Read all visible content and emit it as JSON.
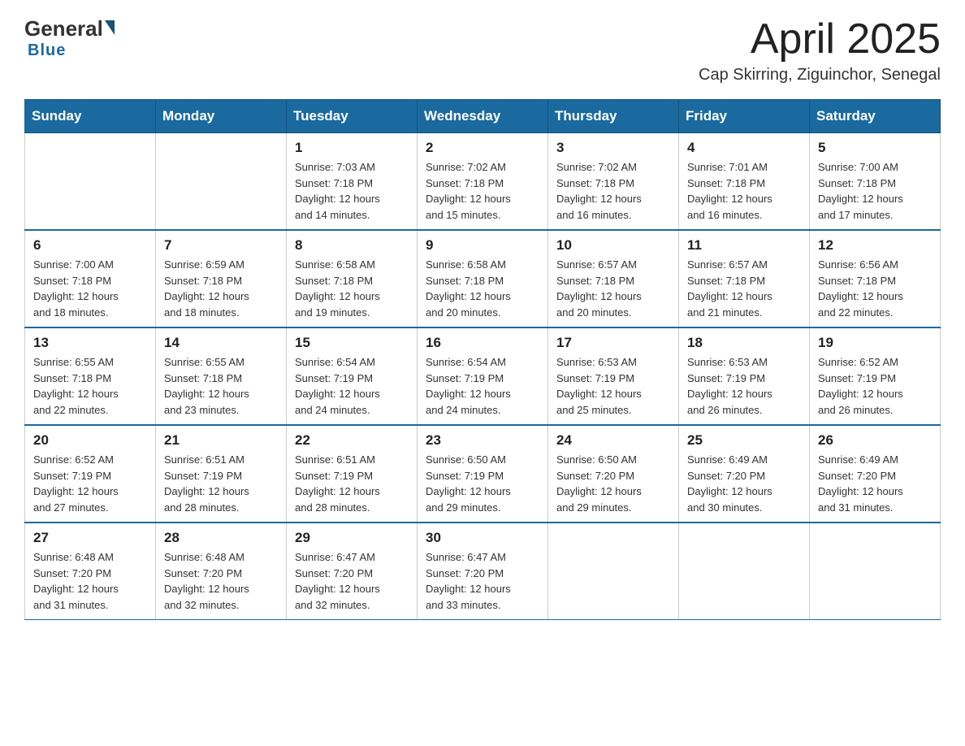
{
  "logo": {
    "general": "General",
    "blue": "Blue"
  },
  "title": {
    "month_year": "April 2025",
    "location": "Cap Skirring, Ziguinchor, Senegal"
  },
  "headers": [
    "Sunday",
    "Monday",
    "Tuesday",
    "Wednesday",
    "Thursday",
    "Friday",
    "Saturday"
  ],
  "weeks": [
    [
      {
        "day": "",
        "info": ""
      },
      {
        "day": "",
        "info": ""
      },
      {
        "day": "1",
        "info": "Sunrise: 7:03 AM\nSunset: 7:18 PM\nDaylight: 12 hours\nand 14 minutes."
      },
      {
        "day": "2",
        "info": "Sunrise: 7:02 AM\nSunset: 7:18 PM\nDaylight: 12 hours\nand 15 minutes."
      },
      {
        "day": "3",
        "info": "Sunrise: 7:02 AM\nSunset: 7:18 PM\nDaylight: 12 hours\nand 16 minutes."
      },
      {
        "day": "4",
        "info": "Sunrise: 7:01 AM\nSunset: 7:18 PM\nDaylight: 12 hours\nand 16 minutes."
      },
      {
        "day": "5",
        "info": "Sunrise: 7:00 AM\nSunset: 7:18 PM\nDaylight: 12 hours\nand 17 minutes."
      }
    ],
    [
      {
        "day": "6",
        "info": "Sunrise: 7:00 AM\nSunset: 7:18 PM\nDaylight: 12 hours\nand 18 minutes."
      },
      {
        "day": "7",
        "info": "Sunrise: 6:59 AM\nSunset: 7:18 PM\nDaylight: 12 hours\nand 18 minutes."
      },
      {
        "day": "8",
        "info": "Sunrise: 6:58 AM\nSunset: 7:18 PM\nDaylight: 12 hours\nand 19 minutes."
      },
      {
        "day": "9",
        "info": "Sunrise: 6:58 AM\nSunset: 7:18 PM\nDaylight: 12 hours\nand 20 minutes."
      },
      {
        "day": "10",
        "info": "Sunrise: 6:57 AM\nSunset: 7:18 PM\nDaylight: 12 hours\nand 20 minutes."
      },
      {
        "day": "11",
        "info": "Sunrise: 6:57 AM\nSunset: 7:18 PM\nDaylight: 12 hours\nand 21 minutes."
      },
      {
        "day": "12",
        "info": "Sunrise: 6:56 AM\nSunset: 7:18 PM\nDaylight: 12 hours\nand 22 minutes."
      }
    ],
    [
      {
        "day": "13",
        "info": "Sunrise: 6:55 AM\nSunset: 7:18 PM\nDaylight: 12 hours\nand 22 minutes."
      },
      {
        "day": "14",
        "info": "Sunrise: 6:55 AM\nSunset: 7:18 PM\nDaylight: 12 hours\nand 23 minutes."
      },
      {
        "day": "15",
        "info": "Sunrise: 6:54 AM\nSunset: 7:19 PM\nDaylight: 12 hours\nand 24 minutes."
      },
      {
        "day": "16",
        "info": "Sunrise: 6:54 AM\nSunset: 7:19 PM\nDaylight: 12 hours\nand 24 minutes."
      },
      {
        "day": "17",
        "info": "Sunrise: 6:53 AM\nSunset: 7:19 PM\nDaylight: 12 hours\nand 25 minutes."
      },
      {
        "day": "18",
        "info": "Sunrise: 6:53 AM\nSunset: 7:19 PM\nDaylight: 12 hours\nand 26 minutes."
      },
      {
        "day": "19",
        "info": "Sunrise: 6:52 AM\nSunset: 7:19 PM\nDaylight: 12 hours\nand 26 minutes."
      }
    ],
    [
      {
        "day": "20",
        "info": "Sunrise: 6:52 AM\nSunset: 7:19 PM\nDaylight: 12 hours\nand 27 minutes."
      },
      {
        "day": "21",
        "info": "Sunrise: 6:51 AM\nSunset: 7:19 PM\nDaylight: 12 hours\nand 28 minutes."
      },
      {
        "day": "22",
        "info": "Sunrise: 6:51 AM\nSunset: 7:19 PM\nDaylight: 12 hours\nand 28 minutes."
      },
      {
        "day": "23",
        "info": "Sunrise: 6:50 AM\nSunset: 7:19 PM\nDaylight: 12 hours\nand 29 minutes."
      },
      {
        "day": "24",
        "info": "Sunrise: 6:50 AM\nSunset: 7:20 PM\nDaylight: 12 hours\nand 29 minutes."
      },
      {
        "day": "25",
        "info": "Sunrise: 6:49 AM\nSunset: 7:20 PM\nDaylight: 12 hours\nand 30 minutes."
      },
      {
        "day": "26",
        "info": "Sunrise: 6:49 AM\nSunset: 7:20 PM\nDaylight: 12 hours\nand 31 minutes."
      }
    ],
    [
      {
        "day": "27",
        "info": "Sunrise: 6:48 AM\nSunset: 7:20 PM\nDaylight: 12 hours\nand 31 minutes."
      },
      {
        "day": "28",
        "info": "Sunrise: 6:48 AM\nSunset: 7:20 PM\nDaylight: 12 hours\nand 32 minutes."
      },
      {
        "day": "29",
        "info": "Sunrise: 6:47 AM\nSunset: 7:20 PM\nDaylight: 12 hours\nand 32 minutes."
      },
      {
        "day": "30",
        "info": "Sunrise: 6:47 AM\nSunset: 7:20 PM\nDaylight: 12 hours\nand 33 minutes."
      },
      {
        "day": "",
        "info": ""
      },
      {
        "day": "",
        "info": ""
      },
      {
        "day": "",
        "info": ""
      }
    ]
  ]
}
